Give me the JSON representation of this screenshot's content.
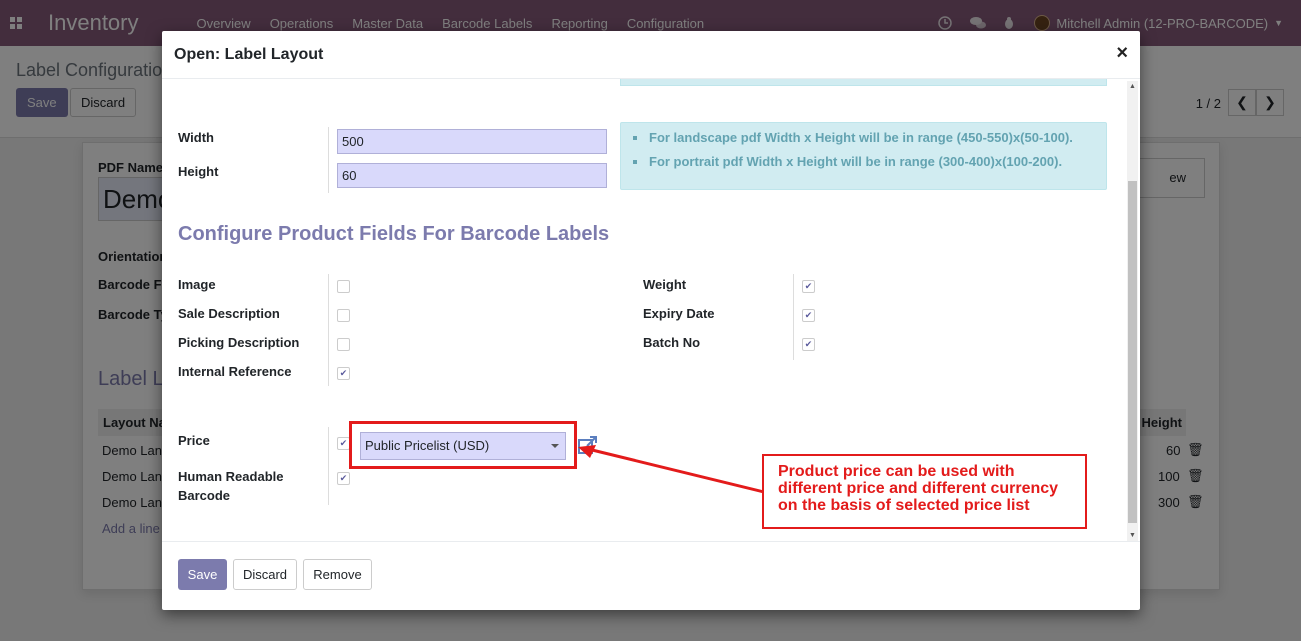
{
  "navbar": {
    "app_title": "Inventory",
    "menu": [
      "Overview",
      "Operations",
      "Master Data",
      "Barcode Labels",
      "Reporting",
      "Configuration"
    ],
    "user": "Mitchell Admin (12-PRO-BARCODE)",
    "background_color": "#875a7b"
  },
  "page": {
    "breadcrumb": "Label Configuratio",
    "save_label": "Save",
    "discard_label": "Discard",
    "pager": "1 / 2",
    "preview_label": "ew",
    "pdf_name_label": "PDF Name",
    "pdf_name_value": "Demo",
    "orientation_label": "Orientation",
    "barcode_format_label": "Barcode F",
    "barcode_type_label": "Barcode Ty",
    "label_layout_title": "Label L",
    "table_header_layout": "Layout Na",
    "table_header_height": "Height",
    "rows": [
      {
        "name": "Demo Lan",
        "height": "60"
      },
      {
        "name": "Demo Lan",
        "height": "100"
      },
      {
        "name": "Demo Lan",
        "height": "300"
      }
    ],
    "add_line": "Add a line"
  },
  "modal": {
    "title": "Open: Label Layout",
    "close": "×",
    "width_label": "Width",
    "width_value": "500",
    "height_label": "Height",
    "height_value": "60",
    "info": [
      "For landscape pdf Width x Height will be in range (450-550)x(50-100).",
      "For portrait pdf Width x Height will be in range (300-400)x(100-200)."
    ],
    "section_title": "Configure Product Fields For Barcode Labels",
    "left_fields": [
      {
        "label": "Image",
        "checked": false
      },
      {
        "label": "Sale Description",
        "checked": false
      },
      {
        "label": "Picking Description",
        "checked": false
      },
      {
        "label": "Internal Reference",
        "checked": true
      }
    ],
    "right_fields": [
      {
        "label": "Weight",
        "checked": true
      },
      {
        "label": "Expiry Date",
        "checked": true
      },
      {
        "label": "Batch No",
        "checked": true
      }
    ],
    "price_label": "Price",
    "price_checked": true,
    "pricelist_value": "Public Pricelist (USD)",
    "human_readable_label_1": "Human Readable",
    "human_readable_label_2": "Barcode",
    "human_readable_checked": true,
    "callout_text": [
      "Product price can be used with",
      "different price and different currency",
      "on the basis of selected price list"
    ],
    "footer": {
      "save": "Save",
      "discard": "Discard",
      "remove": "Remove"
    },
    "accent_color": "#7c7bad",
    "annotation_color": "#e31b1b"
  }
}
